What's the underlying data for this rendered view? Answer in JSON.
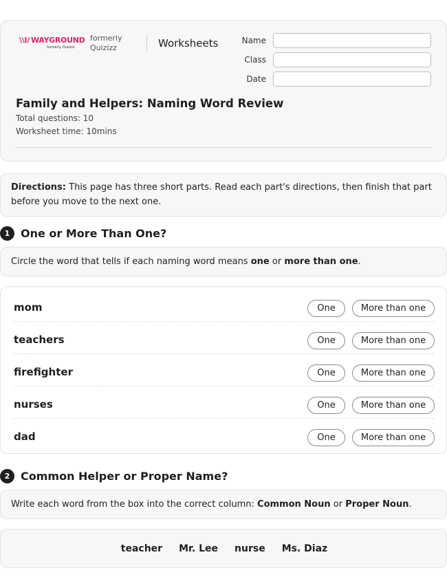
{
  "brand": {
    "logo_text": "WAYGROUND",
    "logo_subtext": "formerly Quizizz",
    "formerly_label": "formerly Quizizz",
    "brand_color": "#d6266b"
  },
  "header": {
    "section_label": "Worksheets",
    "fields": [
      {
        "label": "Name",
        "value": ""
      },
      {
        "label": "Class",
        "value": ""
      },
      {
        "label": "Date",
        "value": ""
      }
    ],
    "title": "Family and Helpers: Naming Word Review",
    "total_questions": "Total questions: 10",
    "worksheet_time": "Worksheet time: 10mins"
  },
  "directions": {
    "label": "Directions:",
    "text": "This page has three short parts. Read each part's directions, then finish that part before you move to the next one."
  },
  "part1": {
    "number": "1",
    "title": "One or More Than One?",
    "instruction_pre": "Circle the word that tells if each naming word means ",
    "instruction_b1": "one",
    "instruction_mid": " or ",
    "instruction_b2": "more than one",
    "instruction_post": ".",
    "option_one": "One",
    "option_more": "More than one",
    "rows": [
      {
        "word": "mom"
      },
      {
        "word": "teachers"
      },
      {
        "word": "firefighter"
      },
      {
        "word": "nurses"
      },
      {
        "word": "dad"
      }
    ]
  },
  "part2": {
    "number": "2",
    "title": "Common Helper or Proper Name?",
    "instruction_pre": "Write each word from the box into the correct column: ",
    "instruction_b1": "Common Noun",
    "instruction_mid": " or ",
    "instruction_b2": "Proper Noun",
    "instruction_post": ".",
    "word_bank": [
      "teacher",
      "Mr. Lee",
      "nurse",
      "Ms. Diaz"
    ]
  }
}
